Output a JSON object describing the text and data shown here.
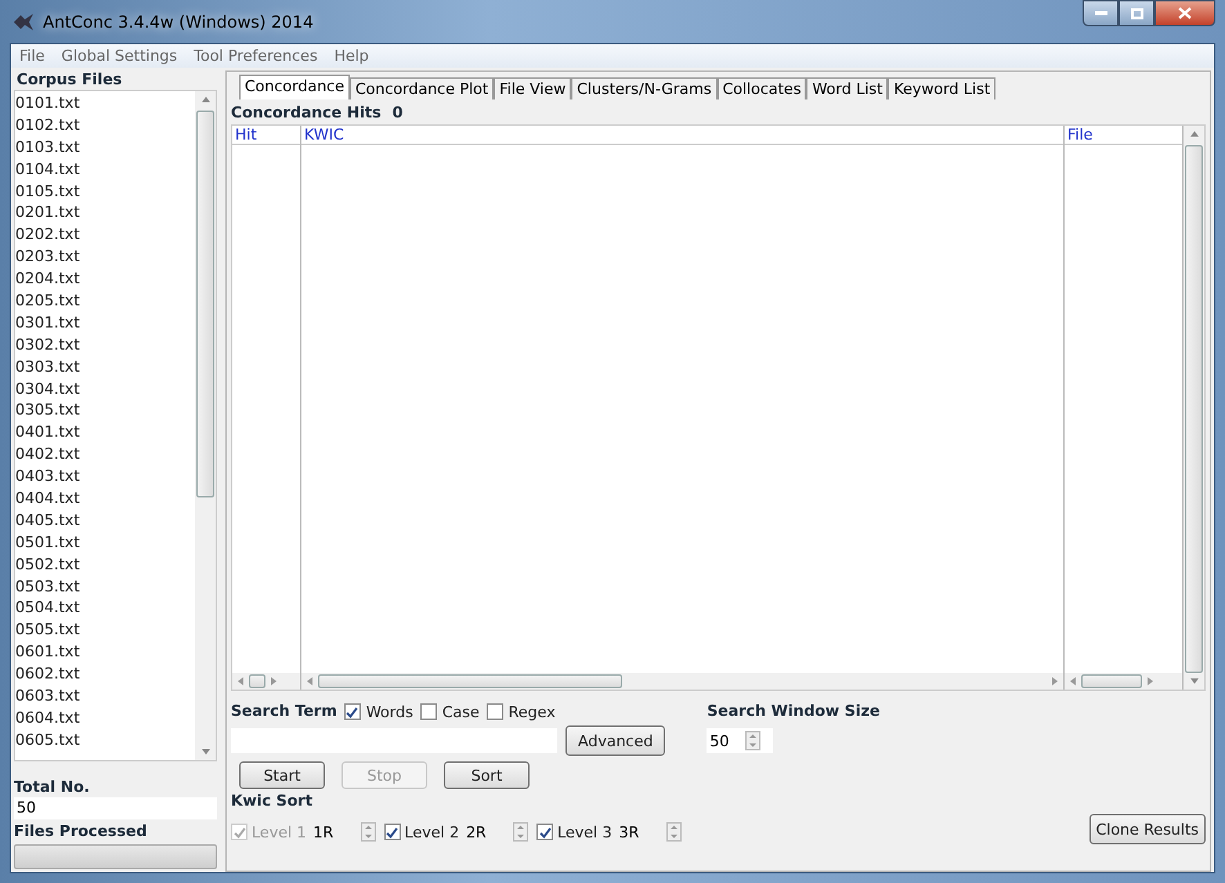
{
  "window": {
    "title": "AntConc 3.4.4w (Windows) 2014"
  },
  "menu": [
    "File",
    "Global Settings",
    "Tool Preferences",
    "Help"
  ],
  "corpus": {
    "heading": "Corpus Files",
    "files": [
      "0101.txt",
      "0102.txt",
      "0103.txt",
      "0104.txt",
      "0105.txt",
      "0201.txt",
      "0202.txt",
      "0203.txt",
      "0204.txt",
      "0205.txt",
      "0301.txt",
      "0302.txt",
      "0303.txt",
      "0304.txt",
      "0305.txt",
      "0401.txt",
      "0402.txt",
      "0403.txt",
      "0404.txt",
      "0405.txt",
      "0501.txt",
      "0502.txt",
      "0503.txt",
      "0504.txt",
      "0505.txt",
      "0601.txt",
      "0602.txt",
      "0603.txt",
      "0604.txt",
      "0605.txt"
    ],
    "total_label": "Total No.",
    "total_value": "50",
    "processed_label": "Files Processed",
    "progress": {
      "level": 0
    }
  },
  "tabs": [
    {
      "label": "Concordance",
      "selected": true
    },
    {
      "label": "Concordance Plot",
      "selected": false
    },
    {
      "label": "File View",
      "selected": false
    },
    {
      "label": "Clusters/N-Grams",
      "selected": false
    },
    {
      "label": "Collocates",
      "selected": false
    },
    {
      "label": "Word List",
      "selected": false
    },
    {
      "label": "Keyword List",
      "selected": false
    }
  ],
  "hits": {
    "label": "Concordance Hits",
    "value": "0"
  },
  "table": {
    "columns": [
      "Hit",
      "KWIC",
      "File"
    ]
  },
  "search": {
    "label": "Search Term",
    "options": [
      {
        "label": "Words",
        "checked": true
      },
      {
        "label": "Case",
        "checked": false
      },
      {
        "label": "Regex",
        "checked": false
      }
    ],
    "advanced": "Advanced",
    "window_label": "Search Window Size",
    "window_value": "50"
  },
  "buttons": [
    {
      "label": "Start",
      "disabled": false
    },
    {
      "label": "Stop",
      "disabled": true
    },
    {
      "label": "Sort",
      "disabled": false
    }
  ],
  "kwic_sort": {
    "label": "Kwic Sort",
    "levels": [
      {
        "label": "Level 1",
        "checked": true,
        "disabled": true,
        "value": "1R"
      },
      {
        "label": "Level 2",
        "checked": true,
        "disabled": false,
        "value": "2R"
      },
      {
        "label": "Level 3",
        "checked": true,
        "disabled": false,
        "value": "3R"
      }
    ]
  },
  "clone": "Clone Results"
}
